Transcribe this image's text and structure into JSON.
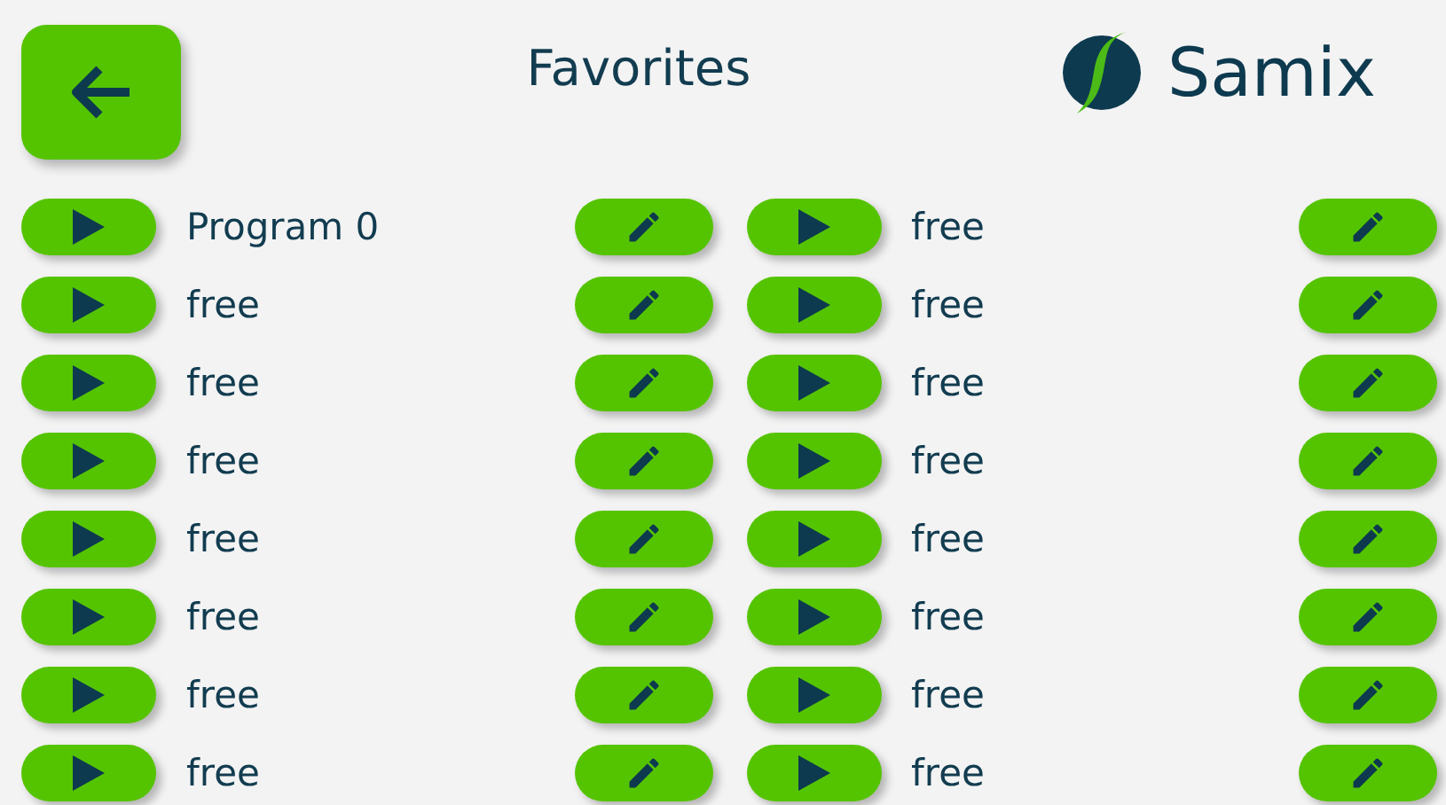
{
  "header": {
    "title": "Favorites",
    "logo": {
      "text": "Samix"
    }
  },
  "slots": [
    {
      "label": "Program 0"
    },
    {
      "label": "free"
    },
    {
      "label": "free"
    },
    {
      "label": "free"
    },
    {
      "label": "free"
    },
    {
      "label": "free"
    },
    {
      "label": "free"
    },
    {
      "label": "free"
    },
    {
      "label": "free"
    },
    {
      "label": "free"
    },
    {
      "label": "free"
    },
    {
      "label": "free"
    },
    {
      "label": "free"
    },
    {
      "label": "free"
    },
    {
      "label": "free"
    },
    {
      "label": "free"
    }
  ]
}
